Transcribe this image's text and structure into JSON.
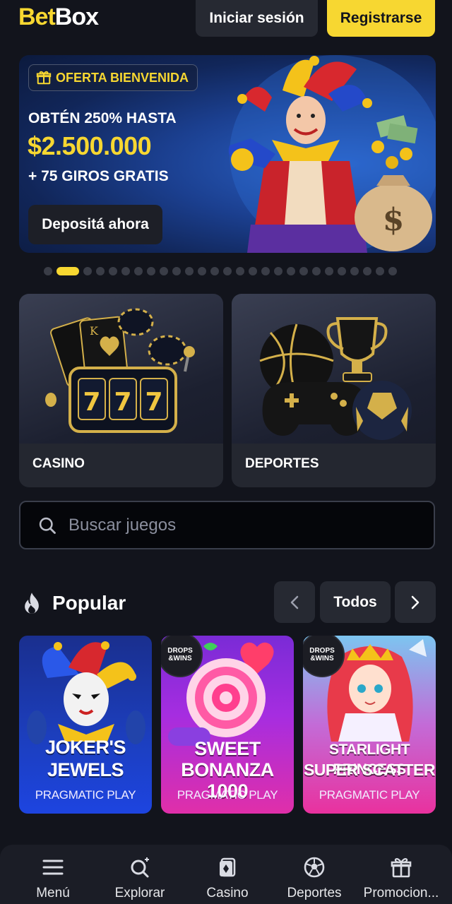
{
  "header": {
    "logo_part1": "Bet",
    "logo_part2": "Box",
    "login_label": "Iniciar sesión",
    "register_label": "Registrarse"
  },
  "banner": {
    "badge": "OFERTA BIENVENIDA",
    "line1": "OBTÉN 250% HASTA",
    "amount": "$2.500.000",
    "line3": "+ 75 GIROS GRATIS",
    "cta": "Depositá ahora",
    "slide_count": 27,
    "active_slide": 2
  },
  "categories": [
    {
      "label": "CASINO"
    },
    {
      "label": "DEPORTES"
    }
  ],
  "search": {
    "placeholder": "Buscar juegos"
  },
  "popular": {
    "title": "Popular",
    "all_label": "Todos",
    "games": [
      {
        "title_line1": "JOKER'S",
        "title_line2": "JEWELS",
        "provider": "PRAGMATIC PLAY"
      },
      {
        "title_line1": "SWEET",
        "title_line2": "BONANZA 1000",
        "provider": "PRAGMATIC PLAY",
        "badge_line1": "DROPS",
        "badge_line2": "&WINS"
      },
      {
        "title_line1": "STARLIGHT PRINCESS",
        "title_line2": "SUPER SCATTER",
        "provider": "PRAGMATIC PLAY",
        "badge_line1": "DROPS",
        "badge_line2": "&WINS"
      }
    ]
  },
  "bottom_nav": [
    {
      "label": "Menú",
      "icon": "menu-icon"
    },
    {
      "label": "Explorar",
      "icon": "explore-icon"
    },
    {
      "label": "Casino",
      "icon": "casino-icon"
    },
    {
      "label": "Deportes",
      "icon": "soccer-ball-icon"
    },
    {
      "label": "Promocion...",
      "icon": "gift-icon"
    }
  ],
  "colors": {
    "accent": "#f7d731",
    "background": "#12141c",
    "surface": "#262932"
  }
}
